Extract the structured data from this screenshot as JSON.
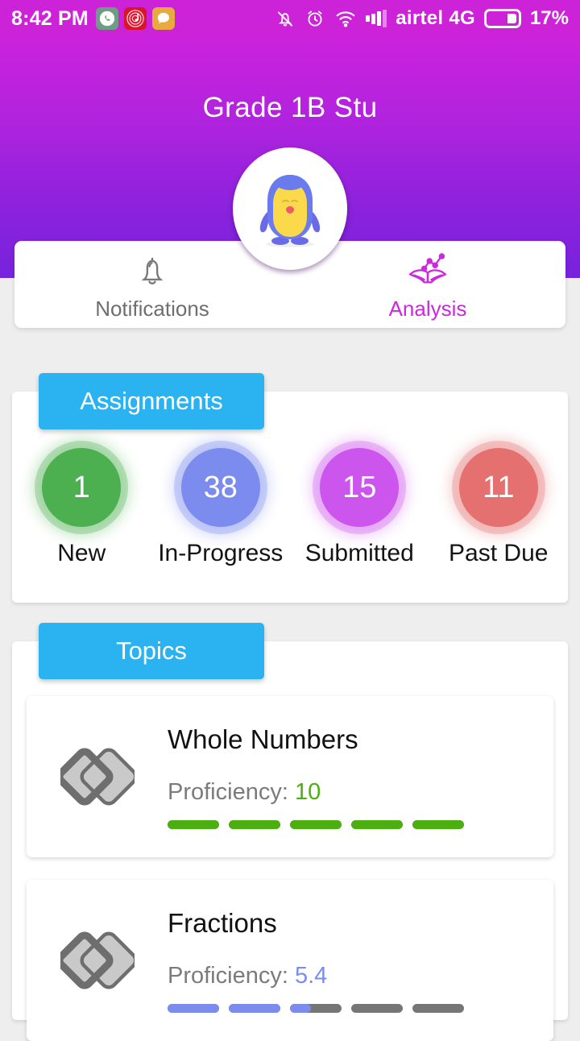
{
  "statusbar": {
    "time": "8:42 PM",
    "app_icons": [
      "whatsapp-icon",
      "music-icon",
      "chat-icon"
    ],
    "right_icons": [
      "vibrate-off-icon",
      "alarm-icon",
      "wifi-icon",
      "signal-icon"
    ],
    "carrier": "airtel 4G",
    "battery_percent": "17%",
    "background": "#cc22d8"
  },
  "header": {
    "title": "Grade 1B Stu",
    "avatar_icon": "penguin-avatar",
    "gradient_from": "#cc22dd",
    "gradient_to": "#7722dd"
  },
  "tabs": [
    {
      "label": "Notifications",
      "icon": "bell-icon",
      "active": false,
      "color": "#6e6e6e"
    },
    {
      "label": "Analysis",
      "icon": "book-chart-icon",
      "active": true,
      "color": "#cc28dd"
    }
  ],
  "assignments": {
    "section_label": "Assignments",
    "badge_color": "#2bb2f0",
    "stats": [
      {
        "value": "1",
        "label": "New",
        "color": "#4caf50",
        "glow": "rgba(76,175,80,.30)"
      },
      {
        "value": "38",
        "label": "In-Progress",
        "color": "#7b8cee",
        "glow": "rgba(123,140,238,.30)"
      },
      {
        "value": "15",
        "label": "Submitted",
        "color": "#cc55ee",
        "glow": "rgba(204,85,238,.30)"
      },
      {
        "value": "11",
        "label": "Past Due",
        "color": "#e4706f",
        "glow": "rgba(228,112,111,.30)"
      }
    ]
  },
  "topics": {
    "section_label": "Topics",
    "badge_color": "#2bb2f0",
    "proficiency_prefix": "Proficiency: ",
    "items": [
      {
        "name": "Whole Numbers",
        "icon": "diamonds-icon",
        "proficiency": "10",
        "proficiency_color": "#4caf10",
        "segments": [
          100,
          100,
          100,
          100,
          100
        ],
        "fill_color": "#4caf10",
        "track_color": "#767676"
      },
      {
        "name": "Fractions",
        "icon": "diamonds-icon",
        "proficiency": "5.4",
        "proficiency_color": "#7b8cee",
        "segments": [
          100,
          100,
          40,
          0,
          0
        ],
        "fill_color": "#7b8cee",
        "track_color": "#767676"
      }
    ]
  }
}
